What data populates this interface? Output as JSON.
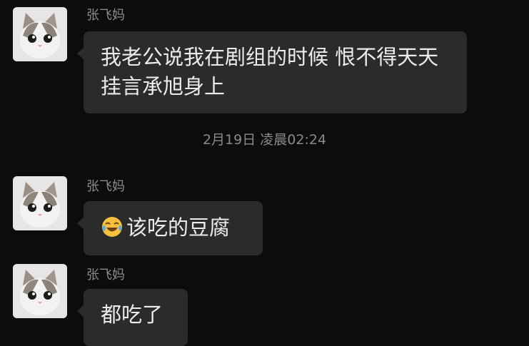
{
  "messages": [
    {
      "sender": "张飞妈",
      "text": "我老公说我在剧组的时候 恨不得天天挂言承旭身上"
    },
    {
      "sender": "张飞妈",
      "emoji": "laughing-crying-emoji",
      "text": "该吃的豆腐"
    },
    {
      "sender": "张飞妈",
      "text": "都吃了"
    }
  ],
  "timestamp": "2月19日 凌晨02:24",
  "colors": {
    "background": "#0c0c0c",
    "bubble": "#2b2b2b",
    "text": "#ececec",
    "meta": "#8a8a8a"
  }
}
